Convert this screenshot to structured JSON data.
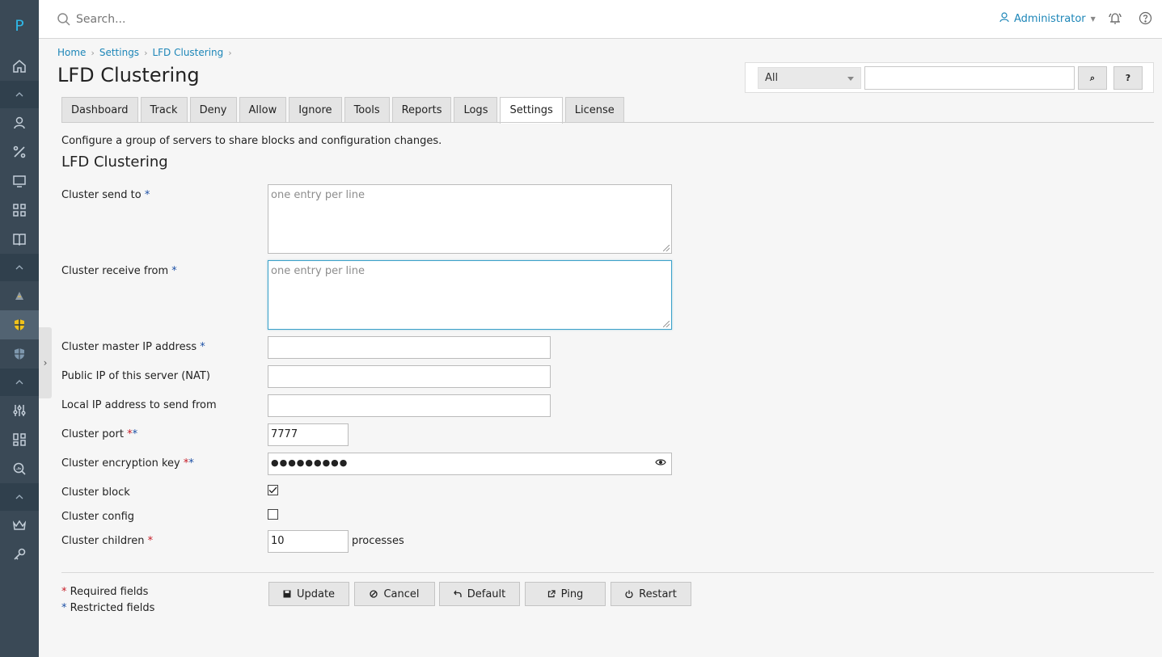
{
  "rail": {
    "logo": "P",
    "icons": [
      "home-icon",
      "collapse-icon",
      "user-icon",
      "percent-icon",
      "monitor-icon",
      "grid-icon",
      "book-icon",
      "collapse-icon",
      "cone-icon",
      "shield-yellow-icon",
      "shield-icon",
      "collapse-icon",
      "sliders-icon",
      "dashboard-icon",
      "magnifier-icon",
      "collapse-icon",
      "crown-icon",
      "key-icon"
    ]
  },
  "topbar": {
    "search_placeholder": "Search...",
    "user": "Administrator"
  },
  "breadcrumb": [
    "Home",
    "Settings",
    "LFD Clustering"
  ],
  "page_title": "LFD Clustering",
  "search_panel": {
    "select_value": "All",
    "search_button": "⌕",
    "help_button": "?"
  },
  "tabs": [
    "Dashboard",
    "Track",
    "Deny",
    "Allow",
    "Ignore",
    "Tools",
    "Reports",
    "Logs",
    "Settings",
    "License"
  ],
  "active_tab": "Settings",
  "description": "Configure a group of servers to share blocks and configuration changes.",
  "section_title": "LFD Clustering",
  "form": {
    "send_to": {
      "label": "Cluster send to ",
      "placeholder": "one entry per line"
    },
    "receive_from": {
      "label": "Cluster receive from ",
      "placeholder": "one entry per line"
    },
    "master_ip": {
      "label": "Cluster master IP address ",
      "value": ""
    },
    "public_ip": {
      "label": "Public IP of this server (NAT)",
      "value": ""
    },
    "local_ip": {
      "label": "Local IP address to send from",
      "value": ""
    },
    "port": {
      "label": "Cluster port ",
      "value": "7777"
    },
    "key": {
      "label": "Cluster encryption key ",
      "value": "●●●●●●●●●"
    },
    "block": {
      "label": "Cluster block",
      "checked": true
    },
    "config": {
      "label": "Cluster config",
      "checked": false
    },
    "children": {
      "label": "Cluster children ",
      "value": "10",
      "suffix": "processes"
    }
  },
  "legend": {
    "required": "Required fields",
    "restricted": "Restricted fields"
  },
  "buttons": {
    "update": "Update",
    "cancel": "Cancel",
    "default": "Default",
    "ping": "Ping",
    "restart": "Restart"
  },
  "colors": {
    "rail": "#3a4956",
    "link": "#1d86b8",
    "required_red": "#c61b26",
    "restricted_blue": "#1b4fa5"
  }
}
